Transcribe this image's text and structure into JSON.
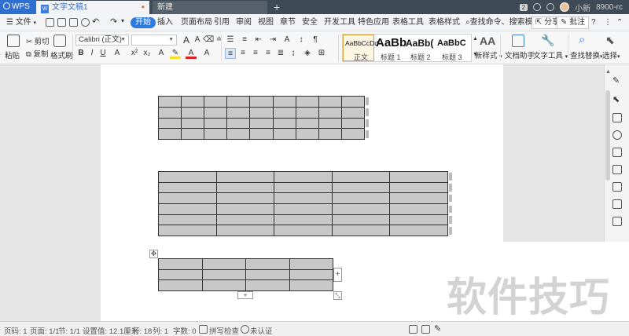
{
  "titlebar": {
    "app_name": "WPS",
    "doc_tab": "文字文稿1",
    "new_tab": "新建",
    "notif_count": "2",
    "user_name": "小新",
    "user_id": "8900-rc"
  },
  "menubar": {
    "file": "文件",
    "tabs": [
      "开始",
      "插入",
      "页面布局",
      "引用",
      "审阅",
      "视图",
      "章节",
      "安全",
      "开发工具",
      "特色应用",
      "表格工具",
      "表格样式"
    ],
    "active_tab": "开始",
    "search": "查找命令、搜索模板",
    "share": "分享",
    "annotate": "批注",
    "help": "?"
  },
  "ribbon": {
    "paste": "粘贴",
    "cut": "剪切",
    "copy": "复制",
    "format_painter": "格式刷",
    "font_name": "Calibri (正文)",
    "font_size": "",
    "styles": [
      {
        "sample": "AaBbCcDd",
        "label": "正文"
      },
      {
        "sample": "AaBb",
        "label": "标题 1"
      },
      {
        "sample": "AaBb(",
        "label": "标题 2"
      },
      {
        "sample": "AaBbC",
        "label": "标题 3"
      }
    ],
    "new_style": "新样式",
    "writer_assistant": "文档助手",
    "text_tools": "文字工具",
    "find_replace": "查找替换",
    "select": "选择"
  },
  "tables": [
    {
      "rows": 4,
      "cols": 9
    },
    {
      "rows": 6,
      "cols": 5
    },
    {
      "rows": 3,
      "cols": 4
    }
  ],
  "watermark": "软件技巧",
  "statusbar": {
    "page_no": "页码: 1",
    "pages": "页面: 1/1",
    "section": "节: 1/1",
    "setting": "设置值: 12.1厘米",
    "row": "行: 18",
    "col": "列: 1",
    "words": "字数: 0",
    "spell_check": "拼写检查",
    "cert": "未认证"
  },
  "colors": {
    "accent": "#2e7be0",
    "titlebar": "#3f4a57",
    "table_fill": "#c8c8c8"
  }
}
